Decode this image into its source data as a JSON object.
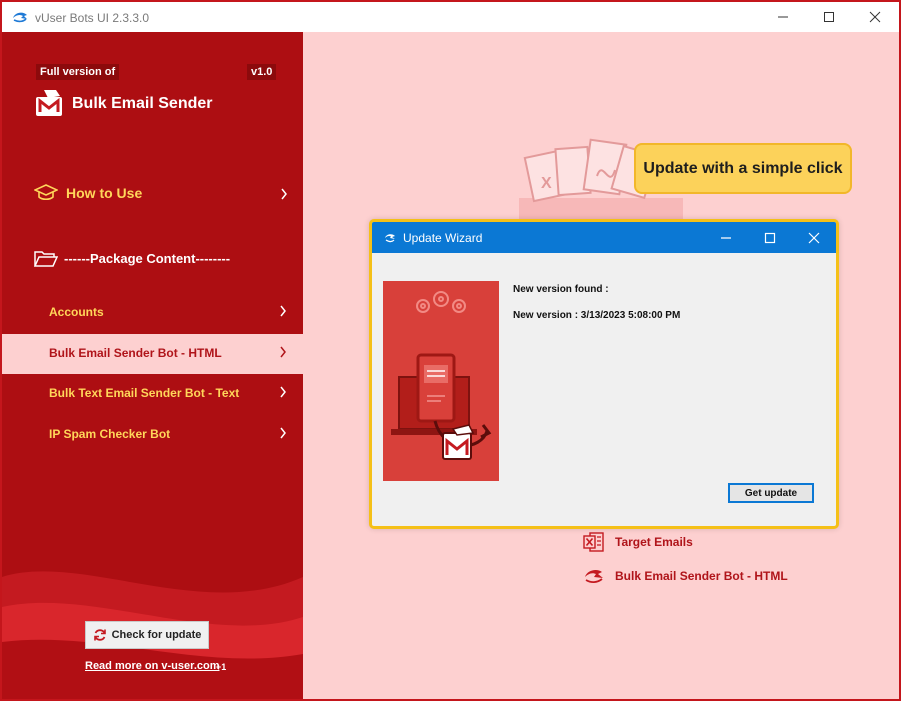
{
  "window": {
    "title": "vUser Bots UI 2.3.3.0",
    "controls": [
      "minimize",
      "maximize",
      "close"
    ]
  },
  "sidebar": {
    "badge_left": "Full version of",
    "badge_right": "v1.0",
    "app_name": "Bulk Email Sender",
    "how_to_use": "How to Use",
    "package_content": "------Package Content--------",
    "items": [
      {
        "label": "Accounts",
        "active": false
      },
      {
        "label": "Bulk Email Sender Bot - HTML",
        "active": true
      },
      {
        "label": "Bulk Text Email Sender Bot - Text",
        "active": false
      },
      {
        "label": "IP Spam Checker Bot",
        "active": false
      }
    ],
    "check_update": "Check for update",
    "read_more": "Read more on v-user.com",
    "plus_one": "+1"
  },
  "main": {
    "callout": "Update with a simple click",
    "files": [
      {
        "label": "Target Emails",
        "icon": "excel-icon"
      },
      {
        "label": "Bulk Email Sender Bot -  HTML",
        "icon": "bot-icon"
      }
    ]
  },
  "wizard": {
    "title": "Update Wizard",
    "new_version_found": "New version found :",
    "new_version": "New version : 3/13/2023 5:08:00 PM",
    "get_update": "Get update"
  },
  "colors": {
    "brand_red": "#ad0e12",
    "accent_yellow": "#ffd65a",
    "main_bg": "#fdd0d0",
    "wizard_blue": "#0b78d4",
    "callout_yellow": "#fcd25a"
  }
}
